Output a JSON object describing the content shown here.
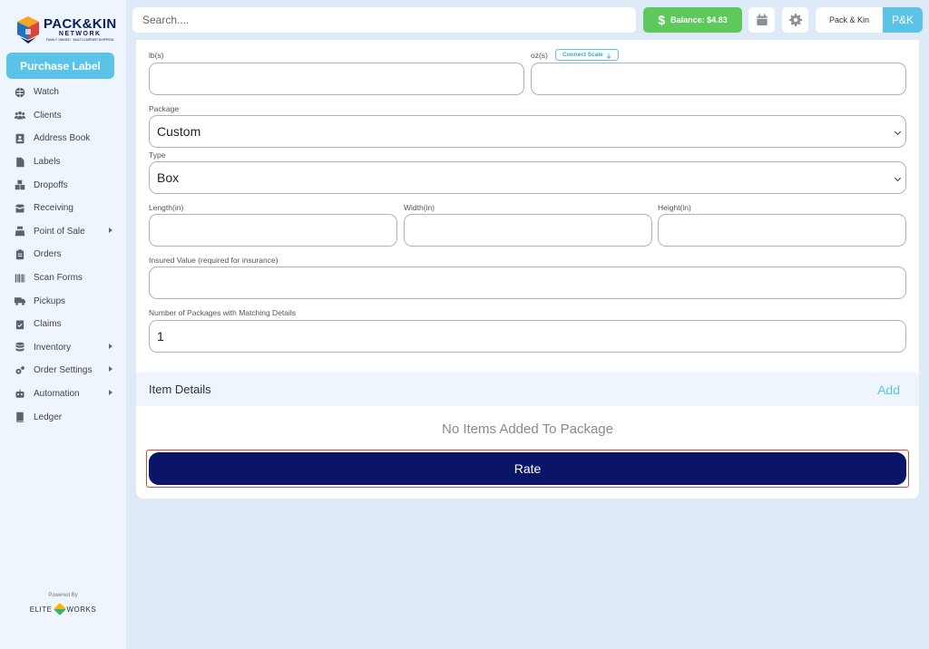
{
  "brand": {
    "name": "PACK&KIN",
    "sub": "NETWORK",
    "tagline": "FAMILY OWNED · MULTI-CARRIER SHIPPING",
    "accent": "#5bc4e6",
    "navy": "#0a1567"
  },
  "sidebar": {
    "purchase_label": "Purchase Label",
    "items": [
      {
        "label": "Watch",
        "icon": "globe-icon"
      },
      {
        "label": "Clients",
        "icon": "users-icon"
      },
      {
        "label": "Address Book",
        "icon": "address-book-icon"
      },
      {
        "label": "Labels",
        "icon": "file-icon"
      },
      {
        "label": "Dropoffs",
        "icon": "boxes-icon"
      },
      {
        "label": "Receiving",
        "icon": "box-open-icon"
      },
      {
        "label": "Point of Sale",
        "icon": "cash-register-icon",
        "submenu": true
      },
      {
        "label": "Orders",
        "icon": "clipboard-icon"
      },
      {
        "label": "Scan Forms",
        "icon": "barcode-icon"
      },
      {
        "label": "Pickups",
        "icon": "truck-icon"
      },
      {
        "label": "Claims",
        "icon": "clipboard-check-icon"
      },
      {
        "label": "Inventory",
        "icon": "database-icon",
        "submenu": true
      },
      {
        "label": "Order Settings",
        "icon": "cogs-icon",
        "submenu": true
      },
      {
        "label": "Automation",
        "icon": "robot-icon",
        "submenu": true
      },
      {
        "label": "Ledger",
        "icon": "book-icon"
      }
    ],
    "powered_by": "Powered By",
    "elite_left": "ELITE",
    "elite_right": "WORKS"
  },
  "topbar": {
    "search_placeholder": "Search....",
    "balance": "Balance: $4.83",
    "balance_symbol": "$",
    "user_name": "Pack & Kin",
    "user_initials": "P&K"
  },
  "form": {
    "lbs_label": "lb(s)",
    "lbs_value": "",
    "oz_label": "oz(s)",
    "oz_value": "",
    "connect_scale": "Connect Scale",
    "package_label": "Package",
    "package_value": "Custom",
    "type_label": "Type",
    "type_value": "Box",
    "length_label": "Length(in)",
    "width_label": "Width(in)",
    "height_label": "Height(in)",
    "insured_label": "Insured Value (required for insurance)",
    "insured_value": "",
    "num_packages_label": "Number of Packages with Matching Details",
    "num_packages_value": "1"
  },
  "items": {
    "title": "Item Details",
    "add": "Add",
    "empty": "No Items Added To Package"
  },
  "rate_button": "Rate"
}
